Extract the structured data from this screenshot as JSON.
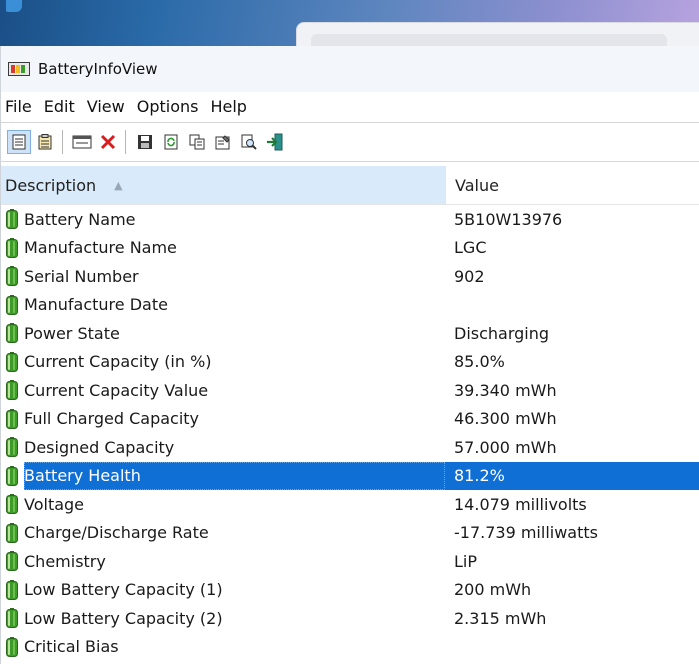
{
  "window": {
    "title": "BatteryInfoView"
  },
  "menu": [
    "File",
    "Edit",
    "View",
    "Options",
    "Help"
  ],
  "toolbar": {
    "buttons": [
      {
        "icon": "html-report-icon"
      },
      {
        "icon": "properties-list-icon"
      },
      {
        "icon": "window-icon"
      },
      {
        "icon": "delete-x-icon"
      },
      {
        "icon": "save-floppy-icon"
      },
      {
        "icon": "refresh-icon"
      },
      {
        "icon": "copy-icon"
      },
      {
        "icon": "properties-icon"
      },
      {
        "icon": "find-icon"
      },
      {
        "icon": "exit-icon"
      }
    ]
  },
  "columns": {
    "description": "Description",
    "value": "Value",
    "sort_indicator": "▲"
  },
  "rows": [
    {
      "description": "Battery Name",
      "value": "5B10W13976"
    },
    {
      "description": "Manufacture Name",
      "value": "LGC"
    },
    {
      "description": "Serial Number",
      "value": " 902"
    },
    {
      "description": "Manufacture Date",
      "value": ""
    },
    {
      "description": "Power State",
      "value": "Discharging"
    },
    {
      "description": "Current Capacity (in %)",
      "value": "85.0%"
    },
    {
      "description": "Current Capacity Value",
      "value": "39.340 mWh"
    },
    {
      "description": "Full Charged Capacity",
      "value": "46.300 mWh"
    },
    {
      "description": "Designed Capacity",
      "value": "57.000 mWh"
    },
    {
      "description": "Battery Health",
      "value": "81.2%",
      "selected": true
    },
    {
      "description": "Voltage",
      "value": "14.079 millivolts"
    },
    {
      "description": "Charge/Discharge Rate",
      "value": "-17.739 milliwatts"
    },
    {
      "description": "Chemistry",
      "value": "LiP"
    },
    {
      "description": "Low Battery Capacity (1)",
      "value": "200 mWh"
    },
    {
      "description": "Low Battery Capacity (2)",
      "value": "2.315 mWh"
    },
    {
      "description": "Critical Bias",
      "value": ""
    }
  ],
  "colors": {
    "selection": "#0f6fd4",
    "header_sorted": "#d9ebfa",
    "battery_icon": "#3e9b2a"
  }
}
